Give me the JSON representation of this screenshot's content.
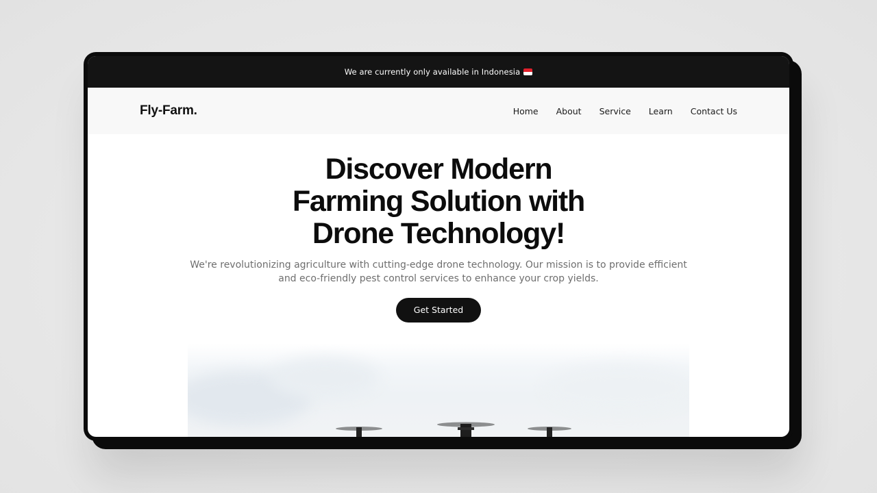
{
  "announcement": {
    "text": "We are currently only available in Indonesia",
    "flag_icon": "indonesia-flag-icon"
  },
  "navbar": {
    "logo": "Fly-Farm.",
    "links": [
      "Home",
      "About",
      "Service",
      "Learn",
      "Contact Us"
    ]
  },
  "hero": {
    "title_lines": [
      "Discover Modern",
      "Farming Solution with",
      "Drone Technology!"
    ],
    "description": "We're revolutionizing agriculture with cutting-edge drone technology. Our mission is to provide efficient and eco-friendly pest control services to enhance your crop yields.",
    "cta_label": "Get Started"
  },
  "colors": {
    "announcement_bg": "#141414",
    "navbar_bg": "#f8f8f8",
    "cta_bg": "#111111",
    "text_primary": "#0c0c0c",
    "text_muted": "#6e6e6e"
  }
}
